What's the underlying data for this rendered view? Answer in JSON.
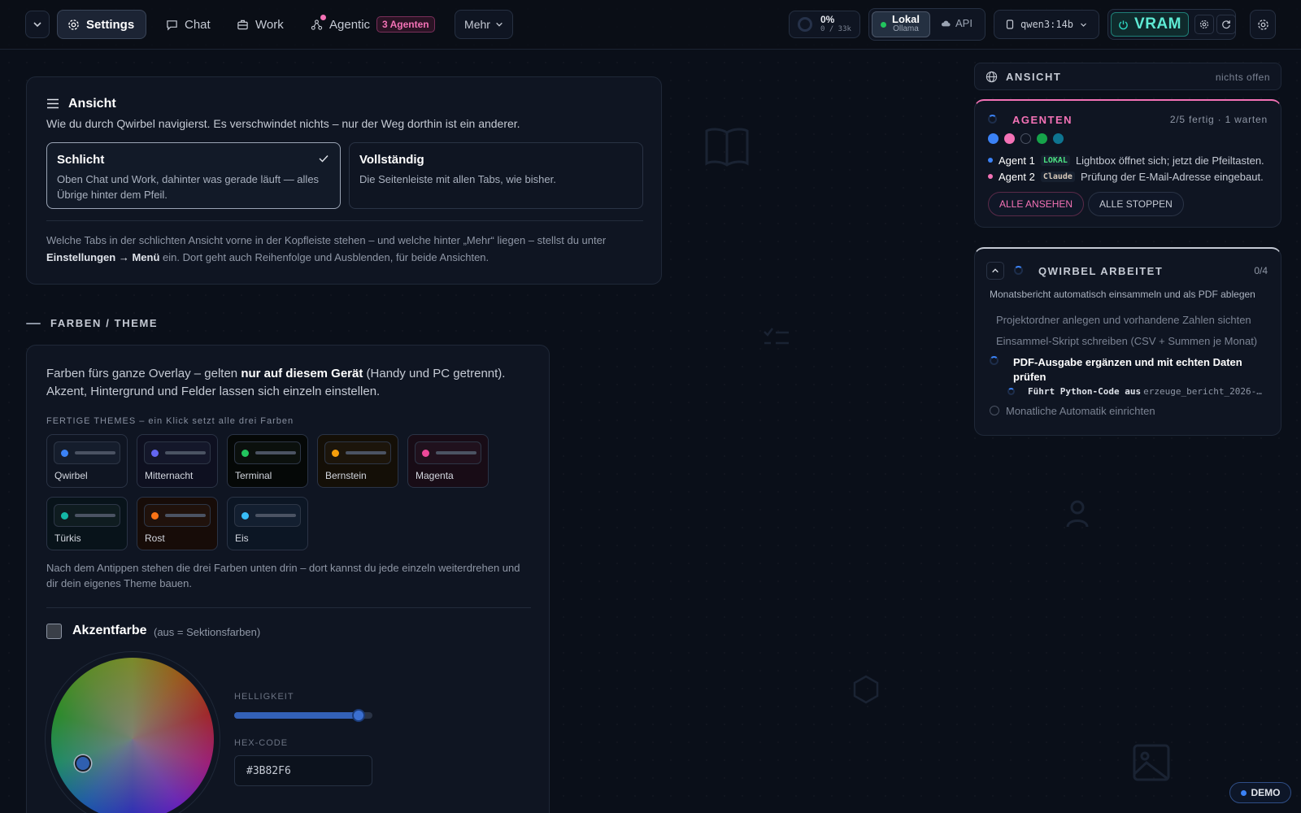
{
  "topbar": {
    "tabs": [
      {
        "label": "Settings",
        "active": true
      },
      {
        "label": "Chat"
      },
      {
        "label": "Work"
      },
      {
        "label": "Agentic"
      }
    ],
    "agents_badge": "3 Agenten",
    "more_label": "Mehr",
    "context_percent": "0%",
    "context_tokens": "0 / 33k",
    "mode_local_label": "Lokal",
    "mode_local_sub": "Ollama",
    "mode_api_label": "API",
    "model_name": "qwen3:14b",
    "vram_label": "VRAM"
  },
  "ansicht_card": {
    "title": "Ansicht",
    "subtitle": "Wie du durch Qwirbel navigierst. Es verschwindet nichts – nur der Weg dorthin ist ein anderer.",
    "options": [
      {
        "title": "Schlicht",
        "desc": "Oben Chat und Work, dahinter was gerade läuft — alles Übrige hinter dem Pfeil.",
        "selected": true
      },
      {
        "title": "Vollständig",
        "desc": "Die Seitenleiste mit allen Tabs, wie bisher.",
        "selected": false
      }
    ],
    "note_part1": "Welche Tabs in der schlichten Ansicht vorne in der Kopfleiste stehen – und welche hinter „Mehr“ liegen – stellst du unter",
    "note_bold": "Einstellungen → Menü",
    "note_part2": "ein. Dort geht auch Reihenfolge und Ausblenden, für beide Ansichten."
  },
  "theme_section": {
    "heading": "FARBEN / THEME",
    "intro_part1": "Farben fürs ganze Overlay – gelten",
    "intro_bold": "nur auf diesem Gerät",
    "intro_part2": "(Handy und PC getrennt). Akzent, Hintergrund und Felder lassen sich einzeln einstellen.",
    "presets_label": "FERTIGE THEMES – ein Klick setzt alle drei Farben",
    "presets": [
      {
        "name": "Qwirbel",
        "dot": "#3b82f6",
        "bg": "#0f1522",
        "prev": "#151d2c"
      },
      {
        "name": "Mitternacht",
        "dot": "#6366f1",
        "bg": "#0e1020",
        "prev": "#14172a"
      },
      {
        "name": "Terminal",
        "dot": "#22c55e",
        "bg": "#050807",
        "prev": "#0b100d"
      },
      {
        "name": "Bernstein",
        "dot": "#f59e0b",
        "bg": "#140f07",
        "prev": "#1c150b"
      },
      {
        "name": "Magenta",
        "dot": "#ec4899",
        "bg": "#180c16",
        "prev": "#20111d"
      },
      {
        "name": "Türkis",
        "dot": "#14b8a6",
        "bg": "#08131a",
        "prev": "#0f1c20"
      },
      {
        "name": "Rost",
        "dot": "#f97316",
        "bg": "#170c08",
        "prev": "#20120c"
      },
      {
        "name": "Eis",
        "dot": "#38bdf8",
        "bg": "#0c1624",
        "prev": "#131f30"
      }
    ],
    "after_note": "Nach dem Antippen stehen die drei Farben unten drin – dort kannst du jede einzeln weiterdrehen und dir dein eigenes Theme bauen.",
    "accent_title": "Akzentfarbe",
    "accent_hint": "(aus = Sektionsfarben)",
    "brightness_label": "HELLIGKEIT",
    "brightness_value": 0.9,
    "hex_label": "HEX-CODE",
    "hex_value": "#3B82F6"
  },
  "right_panel": {
    "ansicht_label": "ANSICHT",
    "ansicht_status": "nichts offen",
    "agents": {
      "title": "AGENTEN",
      "status": "2/5 fertig · 1 warten",
      "dot_colors": [
        "#3b82f6",
        "#f472b6",
        "transparent",
        "#16a34a",
        "#0e7490"
      ],
      "items": [
        {
          "name": "Agent 1",
          "tag": "LOKAL",
          "tag_color": "#4ade80",
          "text": "Lightbox öffnet sich; jetzt die Pfeiltasten.",
          "dot": "#3b82f6"
        },
        {
          "name": "Agent 2",
          "tag": "Claude",
          "tag_color": "#d6c7b8",
          "text": "Prüfung der E-Mail-Adresse eingebaut.",
          "dot": "#f472b6"
        }
      ],
      "btn_view_all": "ALLE ANSEHEN",
      "btn_stop_all": "ALLE STOPPEN"
    },
    "work": {
      "title": "QWIRBEL ARBEITET",
      "count": "0/4",
      "task": "Monatsbericht automatisch einsammeln und als PDF ablegen",
      "steps": [
        "Projektordner anlegen und vorhandene Zahlen sichten",
        "Einsammel-Skript schreiben (CSV + Summen je Monat)"
      ],
      "current_step": "PDF-Ausgabe ergänzen und mit echten Daten prüfen",
      "current_sub_label": "Führt Python-Code aus",
      "current_sub_arg": "erzeuge_bericht_2026-…",
      "pending_step": "Monatliche Automatik einrichten"
    }
  },
  "demo_badge": "DEMO",
  "colors": {
    "accent": "#3b82f6",
    "pink": "#f472b6",
    "green": "#22c55e",
    "vram": "#2dd4bf"
  }
}
